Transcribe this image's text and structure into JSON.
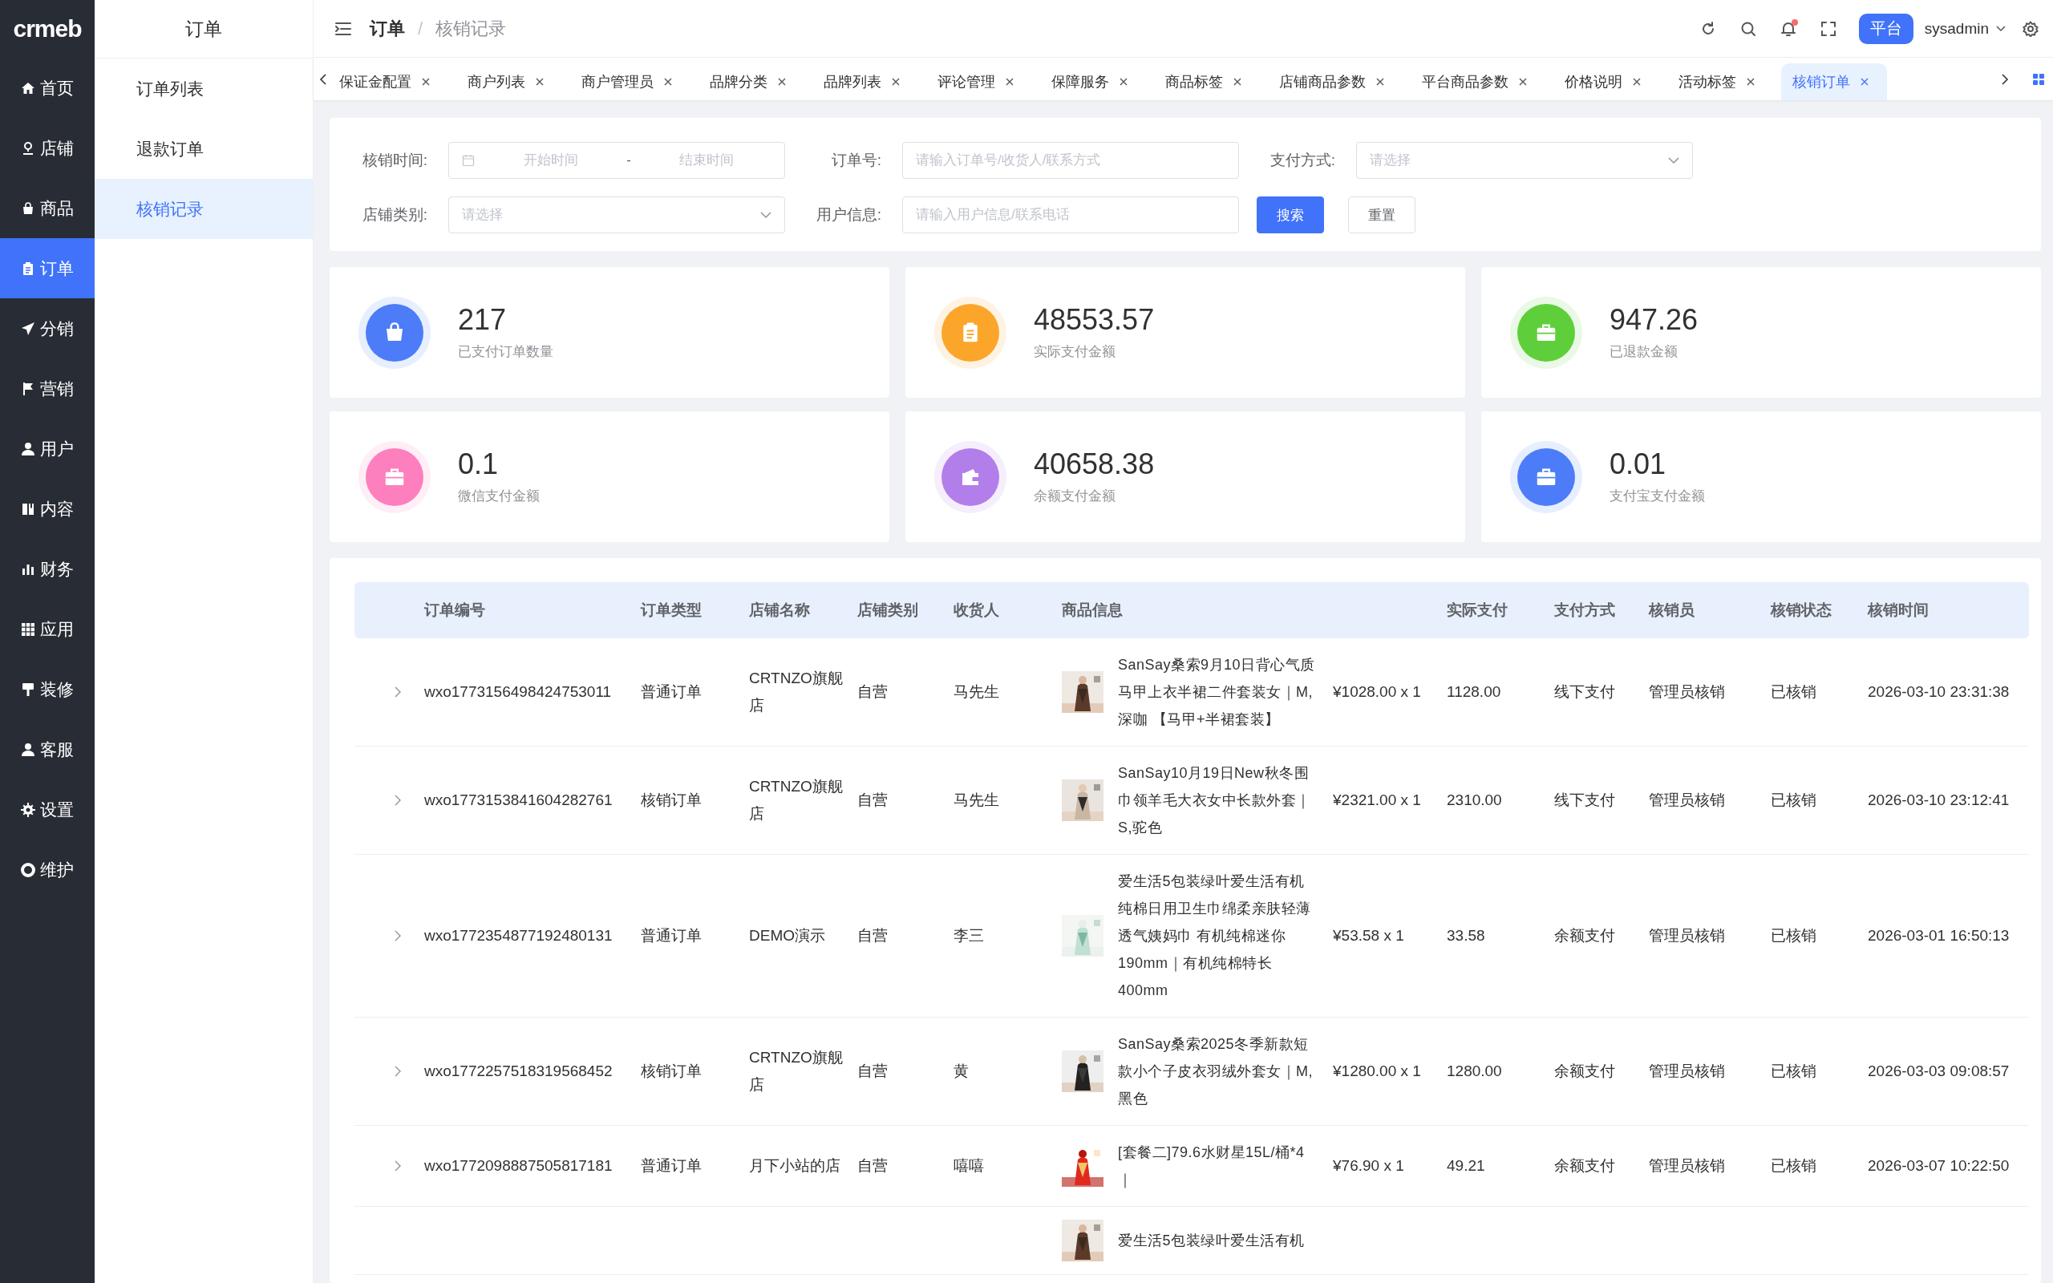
{
  "logo": {
    "text": "crmeb"
  },
  "sidebar": {
    "items": [
      {
        "label": "首页",
        "selected": false
      },
      {
        "label": "店铺",
        "selected": false
      },
      {
        "label": "商品",
        "selected": false
      },
      {
        "label": "订单",
        "selected": true
      },
      {
        "label": "分销",
        "selected": false
      },
      {
        "label": "营销",
        "selected": false
      },
      {
        "label": "用户",
        "selected": false
      },
      {
        "label": "内容",
        "selected": false
      },
      {
        "label": "财务",
        "selected": false
      },
      {
        "label": "应用",
        "selected": false
      },
      {
        "label": "装修",
        "selected": false
      },
      {
        "label": "客服",
        "selected": false
      },
      {
        "label": "设置",
        "selected": false
      },
      {
        "label": "维护",
        "selected": false
      }
    ]
  },
  "submenu": {
    "title": "订单",
    "items": [
      {
        "label": "订单列表",
        "selected": false
      },
      {
        "label": "退款订单",
        "selected": false
      },
      {
        "label": "核销记录",
        "selected": true
      }
    ]
  },
  "header": {
    "breadcrumb": [
      "订单",
      "核销记录"
    ],
    "breadcrumb_separator": "/",
    "has_notification": true,
    "platform_button": "平台",
    "user": "sysadmin"
  },
  "tabs": [
    {
      "label": "保证金配置",
      "selected": false
    },
    {
      "label": "商户列表",
      "selected": false
    },
    {
      "label": "商户管理员",
      "selected": false
    },
    {
      "label": "品牌分类",
      "selected": false
    },
    {
      "label": "品牌列表",
      "selected": false
    },
    {
      "label": "评论管理",
      "selected": false
    },
    {
      "label": "保障服务",
      "selected": false
    },
    {
      "label": "商品标签",
      "selected": false
    },
    {
      "label": "店铺商品参数",
      "selected": false
    },
    {
      "label": "平台商品参数",
      "selected": false
    },
    {
      "label": "价格说明",
      "selected": false
    },
    {
      "label": "活动标签",
      "selected": false
    },
    {
      "label": "核销订单",
      "selected": true
    }
  ],
  "filters": {
    "verify_time": {
      "label": "核销时间:",
      "start_placeholder": "开始时间",
      "separator": "-",
      "end_placeholder": "结束时间"
    },
    "order_no": {
      "label": "订单号:",
      "placeholder": "请输入订单号/收货人/联系方式"
    },
    "pay_method": {
      "label": "支付方式:",
      "placeholder": "请选择"
    },
    "shop_type": {
      "label": "店铺类别:",
      "placeholder": "请选择"
    },
    "user_info": {
      "label": "用户信息:",
      "placeholder": "请输入用户信息/联系电话"
    },
    "search_button": "搜索",
    "reset_button": "重置"
  },
  "stats": [
    {
      "value": "217",
      "label": "已支付订单数量",
      "color": "#4c7cf8"
    },
    {
      "value": "48553.57",
      "label": "实际支付金额",
      "color": "#fba62b"
    },
    {
      "value": "947.26",
      "label": "已退款金额",
      "color": "#5ecf3a"
    },
    {
      "value": "0.1",
      "label": "微信支付金额",
      "color": "#fd7fbd"
    },
    {
      "value": "40658.38",
      "label": "余额支付金额",
      "color": "#b27ee9"
    },
    {
      "value": "0.01",
      "label": "支付宝支付金额",
      "color": "#4c7cf8"
    }
  ],
  "table": {
    "columns": [
      "订单编号",
      "订单类型",
      "店铺名称",
      "店铺类别",
      "收货人",
      "商品信息",
      "实际支付",
      "支付方式",
      "核销员",
      "核销状态",
      "核销时间"
    ],
    "rows": [
      {
        "id": "wxo1773156498424753011",
        "type": "普通订单",
        "shop": "CRTNZO旗舰店",
        "category": "自营",
        "receiver": "马先生",
        "product": "SanSay桑索9月10日背心气质马甲上衣半裙二件套装女｜M,深咖 【马甲+半裙套装】",
        "price": "¥1028.00 x 1",
        "paid": "1128.00",
        "method": "线下支付",
        "verifier": "管理员核销",
        "status": "已核销",
        "time": "2026-03-10 23:31:38"
      },
      {
        "id": "wxo1773153841604282761",
        "type": "核销订单",
        "shop": "CRTNZO旗舰店",
        "category": "自营",
        "receiver": "马先生",
        "product": "SanSay10月19日New秋冬围巾领羊毛大衣女中长款外套｜S,驼色",
        "price": "¥2321.00 x 1",
        "paid": "2310.00",
        "method": "线下支付",
        "verifier": "管理员核销",
        "status": "已核销",
        "time": "2026-03-10 23:12:41"
      },
      {
        "id": "wxo1772354877192480131",
        "type": "普通订单",
        "shop": "DEMO演示",
        "category": "自营",
        "receiver": "李三",
        "product": "爱生活5包装绿叶爱生活有机纯棉日用卫生巾绵柔亲肤轻薄透气姨妈巾 有机纯棉迷你190mm｜有机纯棉特长400mm",
        "price": "¥53.58 x 1",
        "paid": "33.58",
        "method": "余额支付",
        "verifier": "管理员核销",
        "status": "已核销",
        "time": "2026-03-01 16:50:13"
      },
      {
        "id": "wxo1772257518319568452",
        "type": "核销订单",
        "shop": "CRTNZO旗舰店",
        "category": "自营",
        "receiver": "黄",
        "product": "SanSay桑索2025冬季新款短款小个子皮衣羽绒外套女｜M,黑色",
        "price": "¥1280.00 x 1",
        "paid": "1280.00",
        "method": "余额支付",
        "verifier": "管理员核销",
        "status": "已核销",
        "time": "2026-03-03 09:08:57"
      },
      {
        "id": "wxo1772098887505817181",
        "type": "普通订单",
        "shop": "月下小站的店",
        "category": "自营",
        "receiver": "嘻嘻",
        "product": "[套餐二]79.6水财星15L/桶*4｜",
        "price": "¥76.90 x 1",
        "paid": "49.21",
        "method": "余额支付",
        "verifier": "管理员核销",
        "status": "已核销",
        "time": "2026-03-07 10:22:50"
      },
      {
        "product": "爱生活5包装绿叶爱生活有机"
      }
    ]
  }
}
